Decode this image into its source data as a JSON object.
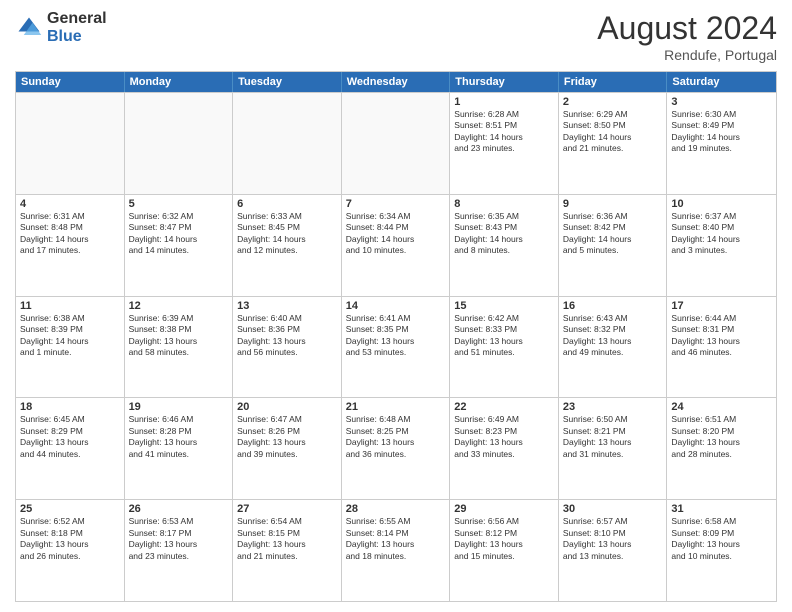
{
  "header": {
    "logo_general": "General",
    "logo_blue": "Blue",
    "title": "August 2024",
    "location": "Rendufe, Portugal"
  },
  "days_of_week": [
    "Sunday",
    "Monday",
    "Tuesday",
    "Wednesday",
    "Thursday",
    "Friday",
    "Saturday"
  ],
  "weeks": [
    [
      {
        "day": "",
        "info": ""
      },
      {
        "day": "",
        "info": ""
      },
      {
        "day": "",
        "info": ""
      },
      {
        "day": "",
        "info": ""
      },
      {
        "day": "1",
        "info": "Sunrise: 6:28 AM\nSunset: 8:51 PM\nDaylight: 14 hours\nand 23 minutes."
      },
      {
        "day": "2",
        "info": "Sunrise: 6:29 AM\nSunset: 8:50 PM\nDaylight: 14 hours\nand 21 minutes."
      },
      {
        "day": "3",
        "info": "Sunrise: 6:30 AM\nSunset: 8:49 PM\nDaylight: 14 hours\nand 19 minutes."
      }
    ],
    [
      {
        "day": "4",
        "info": "Sunrise: 6:31 AM\nSunset: 8:48 PM\nDaylight: 14 hours\nand 17 minutes."
      },
      {
        "day": "5",
        "info": "Sunrise: 6:32 AM\nSunset: 8:47 PM\nDaylight: 14 hours\nand 14 minutes."
      },
      {
        "day": "6",
        "info": "Sunrise: 6:33 AM\nSunset: 8:45 PM\nDaylight: 14 hours\nand 12 minutes."
      },
      {
        "day": "7",
        "info": "Sunrise: 6:34 AM\nSunset: 8:44 PM\nDaylight: 14 hours\nand 10 minutes."
      },
      {
        "day": "8",
        "info": "Sunrise: 6:35 AM\nSunset: 8:43 PM\nDaylight: 14 hours\nand 8 minutes."
      },
      {
        "day": "9",
        "info": "Sunrise: 6:36 AM\nSunset: 8:42 PM\nDaylight: 14 hours\nand 5 minutes."
      },
      {
        "day": "10",
        "info": "Sunrise: 6:37 AM\nSunset: 8:40 PM\nDaylight: 14 hours\nand 3 minutes."
      }
    ],
    [
      {
        "day": "11",
        "info": "Sunrise: 6:38 AM\nSunset: 8:39 PM\nDaylight: 14 hours\nand 1 minute."
      },
      {
        "day": "12",
        "info": "Sunrise: 6:39 AM\nSunset: 8:38 PM\nDaylight: 13 hours\nand 58 minutes."
      },
      {
        "day": "13",
        "info": "Sunrise: 6:40 AM\nSunset: 8:36 PM\nDaylight: 13 hours\nand 56 minutes."
      },
      {
        "day": "14",
        "info": "Sunrise: 6:41 AM\nSunset: 8:35 PM\nDaylight: 13 hours\nand 53 minutes."
      },
      {
        "day": "15",
        "info": "Sunrise: 6:42 AM\nSunset: 8:33 PM\nDaylight: 13 hours\nand 51 minutes."
      },
      {
        "day": "16",
        "info": "Sunrise: 6:43 AM\nSunset: 8:32 PM\nDaylight: 13 hours\nand 49 minutes."
      },
      {
        "day": "17",
        "info": "Sunrise: 6:44 AM\nSunset: 8:31 PM\nDaylight: 13 hours\nand 46 minutes."
      }
    ],
    [
      {
        "day": "18",
        "info": "Sunrise: 6:45 AM\nSunset: 8:29 PM\nDaylight: 13 hours\nand 44 minutes."
      },
      {
        "day": "19",
        "info": "Sunrise: 6:46 AM\nSunset: 8:28 PM\nDaylight: 13 hours\nand 41 minutes."
      },
      {
        "day": "20",
        "info": "Sunrise: 6:47 AM\nSunset: 8:26 PM\nDaylight: 13 hours\nand 39 minutes."
      },
      {
        "day": "21",
        "info": "Sunrise: 6:48 AM\nSunset: 8:25 PM\nDaylight: 13 hours\nand 36 minutes."
      },
      {
        "day": "22",
        "info": "Sunrise: 6:49 AM\nSunset: 8:23 PM\nDaylight: 13 hours\nand 33 minutes."
      },
      {
        "day": "23",
        "info": "Sunrise: 6:50 AM\nSunset: 8:21 PM\nDaylight: 13 hours\nand 31 minutes."
      },
      {
        "day": "24",
        "info": "Sunrise: 6:51 AM\nSunset: 8:20 PM\nDaylight: 13 hours\nand 28 minutes."
      }
    ],
    [
      {
        "day": "25",
        "info": "Sunrise: 6:52 AM\nSunset: 8:18 PM\nDaylight: 13 hours\nand 26 minutes."
      },
      {
        "day": "26",
        "info": "Sunrise: 6:53 AM\nSunset: 8:17 PM\nDaylight: 13 hours\nand 23 minutes."
      },
      {
        "day": "27",
        "info": "Sunrise: 6:54 AM\nSunset: 8:15 PM\nDaylight: 13 hours\nand 21 minutes."
      },
      {
        "day": "28",
        "info": "Sunrise: 6:55 AM\nSunset: 8:14 PM\nDaylight: 13 hours\nand 18 minutes."
      },
      {
        "day": "29",
        "info": "Sunrise: 6:56 AM\nSunset: 8:12 PM\nDaylight: 13 hours\nand 15 minutes."
      },
      {
        "day": "30",
        "info": "Sunrise: 6:57 AM\nSunset: 8:10 PM\nDaylight: 13 hours\nand 13 minutes."
      },
      {
        "day": "31",
        "info": "Sunrise: 6:58 AM\nSunset: 8:09 PM\nDaylight: 13 hours\nand 10 minutes."
      }
    ]
  ]
}
